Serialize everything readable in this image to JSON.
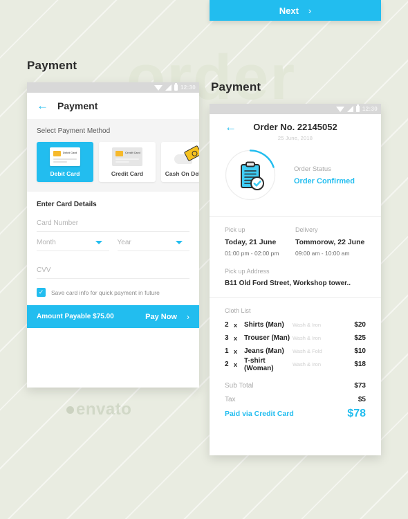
{
  "theme": {
    "accent": "#22bdef",
    "background": "#e9ece1",
    "card": "#ffffff",
    "muted": "#a9a9a9"
  },
  "watermarks": {
    "order_text": "order",
    "envato": "envato"
  },
  "next_button": {
    "label": "Next",
    "chevron": "›"
  },
  "left_screen": {
    "section_title": "Payment",
    "statusbar": {
      "time": "12:30",
      "icons": [
        "wifi-icon",
        "signal-icon",
        "battery-icon"
      ]
    },
    "appbar": {
      "back": "←",
      "title": "Payment"
    },
    "select_label": "Select Payment Method",
    "methods": [
      {
        "label": "Debit Card",
        "card_text": "Debit Card",
        "selected": true,
        "icon": "debit-card-icon"
      },
      {
        "label": "Credit Card",
        "card_text": "Credit Card",
        "selected": false,
        "icon": "credit-card-icon"
      },
      {
        "label": "Cash On Delivery",
        "card_text": "",
        "selected": false,
        "icon": "cash-on-delivery-icon"
      }
    ],
    "card_details": {
      "title": "Enter Card Details",
      "card_number_placeholder": "Card Number",
      "month_placeholder": "Month",
      "year_placeholder": "Year",
      "cvv_placeholder": "CVV",
      "save_checkbox_label": "Save card info for quick payment in future",
      "save_checked": true,
      "check_glyph": "✓"
    },
    "pay_bar": {
      "amount_label": "Amount Payable $75.00",
      "action_label": "Pay Now",
      "chevron": "›"
    }
  },
  "right_screen": {
    "section_title": "Payment",
    "statusbar": {
      "time": "12:30",
      "icons": [
        "wifi-icon",
        "signal-icon",
        "battery-icon"
      ]
    },
    "header": {
      "back": "←",
      "order_no": "Order No. 22145052",
      "date": "25 June, 2018"
    },
    "status": {
      "label": "Order Status",
      "value": "Order Confirmed",
      "icon": "clipboard-check-icon",
      "progress_pct": 30
    },
    "pickup": {
      "label": "Pick up",
      "day": "Today, 21 June",
      "window": "01:00 pm - 02:00 pm"
    },
    "delivery": {
      "label": "Delivery",
      "day": "Tommorow, 22 June",
      "window": "09:00 am - 10:00 am"
    },
    "address": {
      "label": "Pick up Address",
      "value": "B11 Old Ford Street, Workshop tower.."
    },
    "cloth_list": {
      "label": "Cloth List",
      "items": [
        {
          "qty": "2",
          "x": "x",
          "name": "Shirts (Man)",
          "service": "Wash & Iron",
          "price": "$20"
        },
        {
          "qty": "3",
          "x": "x",
          "name": "Trouser (Man)",
          "service": "Wash & Iron",
          "price": "$25"
        },
        {
          "qty": "1",
          "x": "x",
          "name": "Jeans (Man)",
          "service": "Wash & Fold",
          "price": "$10"
        },
        {
          "qty": "2",
          "x": "x",
          "name": "T-shirt (Woman)",
          "service": "Wash & Iron",
          "price": "$18"
        }
      ]
    },
    "totals": {
      "subtotal_label": "Sub Total",
      "subtotal_value": "$73",
      "tax_label": "Tax",
      "tax_value": "$5",
      "paid_label": "Paid via Credit Card",
      "paid_value": "$78"
    }
  }
}
